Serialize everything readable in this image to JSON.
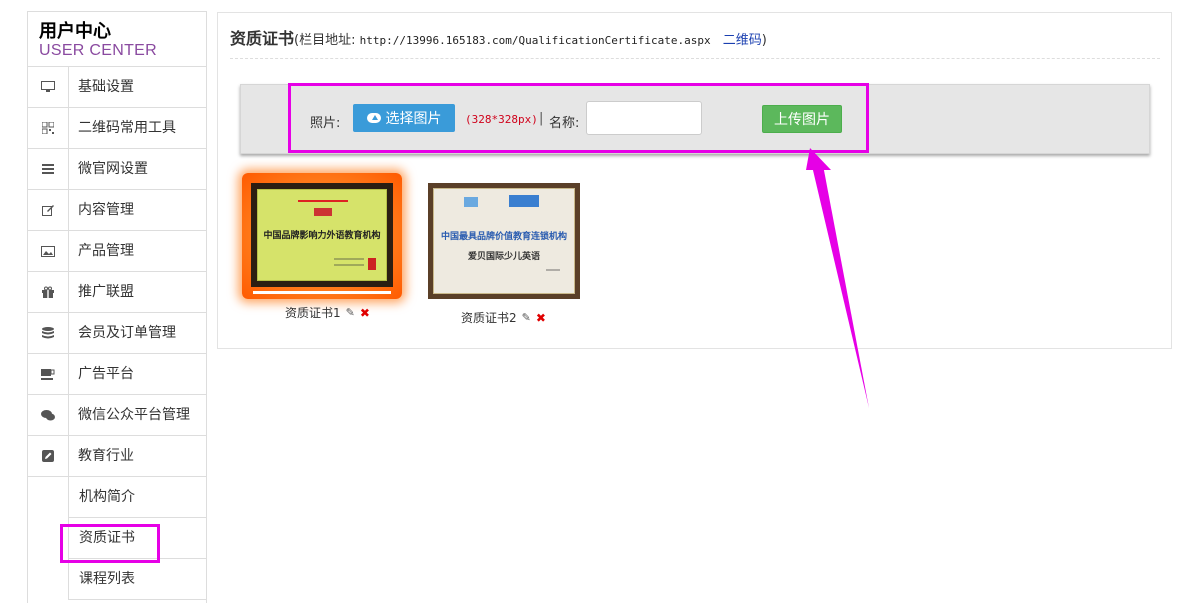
{
  "sidebar": {
    "title": "用户中心",
    "subtitle": "USER CENTER",
    "items": [
      {
        "label": "基础设置",
        "icon": "monitor-icon"
      },
      {
        "label": "二维码常用工具",
        "icon": "qrcode-icon"
      },
      {
        "label": "微官网设置",
        "icon": "list-icon"
      },
      {
        "label": "内容管理",
        "icon": "edit-icon"
      },
      {
        "label": "产品管理",
        "icon": "image-icon"
      },
      {
        "label": "推广联盟",
        "icon": "gift-icon"
      },
      {
        "label": "会员及订单管理",
        "icon": "database-icon"
      },
      {
        "label": "广告平台",
        "icon": "coffee-icon"
      },
      {
        "label": "微信公众平台管理",
        "icon": "chat-icon"
      },
      {
        "label": "教育行业",
        "icon": "pencil-square-icon"
      }
    ],
    "sub_items": [
      {
        "label": "机构简介"
      },
      {
        "label": "资质证书"
      },
      {
        "label": "课程列表"
      }
    ]
  },
  "main": {
    "title": "资质证书",
    "url_prefix": "(栏目地址:",
    "url": "http://13996.165183.com/QualificationCertificate.aspx",
    "qr_link": "二维码",
    "url_suffix": ")"
  },
  "upload": {
    "photo_label": "照片:",
    "choose_button": "选择图片",
    "size_hint": "(328*328px)",
    "separator": "|",
    "name_label": "名称:",
    "name_value": "",
    "upload_button": "上传图片"
  },
  "certificates": [
    {
      "name": "资质证书1",
      "plaque_text": "中国品牌影响力外语教育机构"
    },
    {
      "name": "资质证书2",
      "plaque_text": "中国最具品牌价值教育连锁机构",
      "plaque_sub": "爱贝国际少儿英语"
    }
  ],
  "colors": {
    "highlight": "#e600e6",
    "choose_button": "#3a9bd9",
    "upload_button": "#5cb85c",
    "size_hint": "#d0021b",
    "subtitle": "#8a4aa0"
  }
}
